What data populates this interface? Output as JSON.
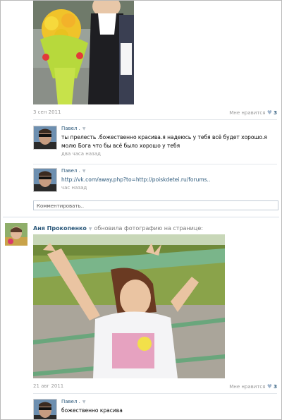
{
  "post1": {
    "date": "3 сен 2011",
    "likes_label": "Мне нравится",
    "likes_count": "3"
  },
  "comments1": [
    {
      "author": "Павел .",
      "text": "ты прелесть .божественно красива.я надеюсь у тебя всё будет хорошо.я молю Бога что бы всё было хорошо у тебя",
      "time": "два часа назад"
    },
    {
      "author": "Павел .",
      "text": "http://vk.com/away.php?to=http://poiskdetei.ru/forums..",
      "time": "час назад"
    }
  ],
  "comment_input": {
    "placeholder": "Комментировать.."
  },
  "post2": {
    "author": "Аня Прокопенко",
    "action": "обновила фотографию на странице:",
    "date": "21 авг 2011",
    "likes_label": "Мне нравится",
    "likes_count": "3"
  },
  "comments2": [
    {
      "author": "Павел .",
      "text": "божественно красива"
    }
  ],
  "icons": {
    "dropdown": "chevron-down-icon",
    "like": "heart-icon"
  }
}
